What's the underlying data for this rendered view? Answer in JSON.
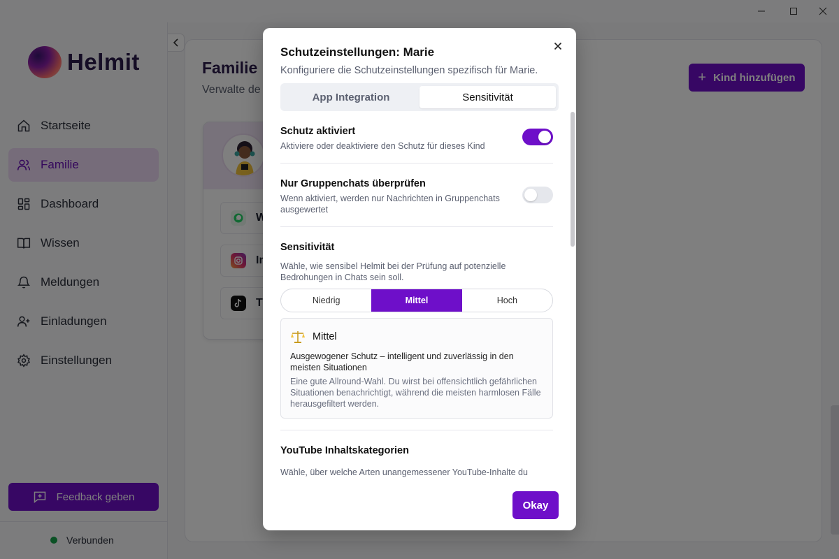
{
  "app": {
    "name": "Helmit"
  },
  "sidebar": {
    "items": [
      {
        "label": "Startseite",
        "icon": "home-icon"
      },
      {
        "label": "Familie",
        "icon": "users-icon",
        "active": true
      },
      {
        "label": "Dashboard",
        "icon": "dashboard-icon"
      },
      {
        "label": "Wissen",
        "icon": "book-icon"
      },
      {
        "label": "Meldungen",
        "icon": "bell-icon"
      },
      {
        "label": "Einladungen",
        "icon": "user-plus-icon"
      },
      {
        "label": "Einstellungen",
        "icon": "gear-icon"
      }
    ],
    "feedback_label": "Feedback geben",
    "status_label": "Verbunden",
    "status_color": "#16a34a"
  },
  "page": {
    "title": "Familie",
    "subtitle": "Verwalte de",
    "add_button_label": "Kind hinzufügen",
    "child_apps": [
      {
        "label": "W",
        "icon": "whatsapp-icon"
      },
      {
        "label": "In",
        "icon": "instagram-icon"
      },
      {
        "label": "Ti",
        "icon": "tiktok-icon"
      }
    ]
  },
  "modal": {
    "title": "Schutzeinstellungen: Marie",
    "subtitle": "Konfiguriere die Schutzeinstellungen spezifisch für Marie.",
    "tabs": [
      {
        "label": "App Integration",
        "active": false
      },
      {
        "label": "Sensitivität",
        "active": true
      }
    ],
    "protection": {
      "title": "Schutz aktiviert",
      "description": "Aktiviere oder deaktiviere den Schutz für dieses Kind",
      "enabled": true
    },
    "group_only": {
      "title": "Nur Gruppenchats überprüfen",
      "description": "Wenn aktiviert, werden nur Nachrichten in Gruppenchats ausgewertet",
      "enabled": false
    },
    "sensitivity": {
      "title": "Sensitivität",
      "description": "Wähle, wie sensibel Helmit bei der Prüfung auf potenzielle Bedrohungen in Chats sein soll.",
      "options": [
        "Niedrig",
        "Mittel",
        "Hoch"
      ],
      "selected": "Mittel",
      "info_title": "Mittel",
      "info_icon": "scale-icon",
      "info_main": "Ausgewogener Schutz – intelligent und zuverlässig in den meisten Situationen",
      "info_extra": "Eine gute Allround-Wahl. Du wirst bei offensichtlich gefährlichen Situationen benachrichtigt, während die meisten harmlosen Fälle herausgefiltert werden."
    },
    "youtube": {
      "title": "YouTube Inhaltskategorien",
      "description": "Wähle, über welche Arten unangemessener YouTube-Inhalte du"
    },
    "ok_label": "Okay"
  },
  "colors": {
    "accent": "#6e0fc9",
    "active_bg": "#ecd9f5"
  }
}
